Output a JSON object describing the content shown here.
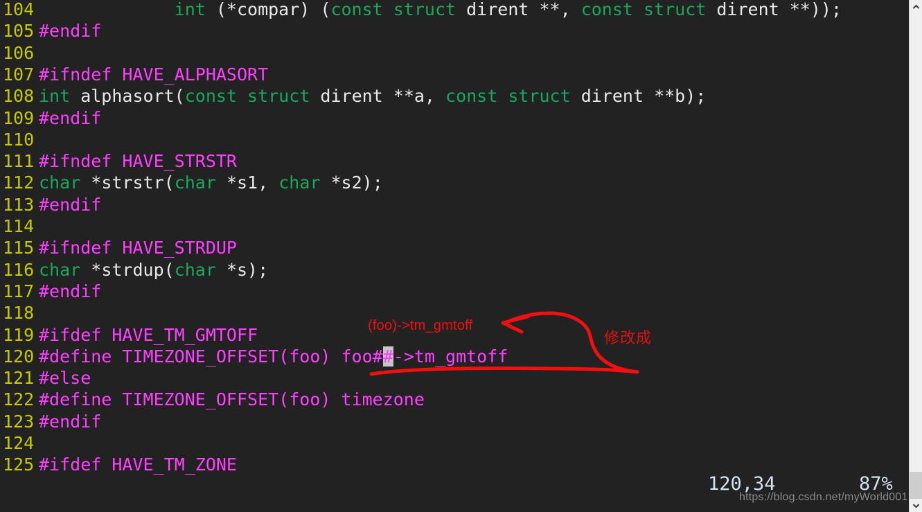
{
  "editor": {
    "kind": "vim-terminal-editor",
    "background_color": "#222222",
    "lines": [
      {
        "number": "104",
        "tokens": [
          {
            "t": "             ",
            "c": "plain"
          },
          {
            "t": "int",
            "c": "type"
          },
          {
            "t": " (*compar) (",
            "c": "plain"
          },
          {
            "t": "const struct",
            "c": "type"
          },
          {
            "t": " dirent **, ",
            "c": "plain"
          },
          {
            "t": "const struct",
            "c": "type"
          },
          {
            "t": " dirent **));",
            "c": "plain"
          }
        ]
      },
      {
        "number": "105",
        "tokens": [
          {
            "t": "#endif",
            "c": "pre"
          }
        ]
      },
      {
        "number": "106",
        "tokens": [
          {
            "t": "",
            "c": "plain"
          }
        ]
      },
      {
        "number": "107",
        "tokens": [
          {
            "t": "#ifndef HAVE_ALPHASORT",
            "c": "pre"
          }
        ]
      },
      {
        "number": "108",
        "tokens": [
          {
            "t": "int",
            "c": "type"
          },
          {
            "t": " alphasort(",
            "c": "plain"
          },
          {
            "t": "const struct",
            "c": "type"
          },
          {
            "t": " dirent **a, ",
            "c": "plain"
          },
          {
            "t": "const struct",
            "c": "type"
          },
          {
            "t": " dirent **b);",
            "c": "plain"
          }
        ]
      },
      {
        "number": "109",
        "tokens": [
          {
            "t": "#endif",
            "c": "pre"
          }
        ]
      },
      {
        "number": "110",
        "tokens": [
          {
            "t": "",
            "c": "plain"
          }
        ]
      },
      {
        "number": "111",
        "tokens": [
          {
            "t": "#ifndef HAVE_STRSTR",
            "c": "pre"
          }
        ]
      },
      {
        "number": "112",
        "tokens": [
          {
            "t": "char",
            "c": "type"
          },
          {
            "t": " *strstr(",
            "c": "plain"
          },
          {
            "t": "char",
            "c": "type"
          },
          {
            "t": " *s1, ",
            "c": "plain"
          },
          {
            "t": "char",
            "c": "type"
          },
          {
            "t": " *s2);",
            "c": "plain"
          }
        ]
      },
      {
        "number": "113",
        "tokens": [
          {
            "t": "#endif",
            "c": "pre"
          }
        ]
      },
      {
        "number": "114",
        "tokens": [
          {
            "t": "",
            "c": "plain"
          }
        ]
      },
      {
        "number": "115",
        "tokens": [
          {
            "t": "#ifndef HAVE_STRDUP",
            "c": "pre"
          }
        ]
      },
      {
        "number": "116",
        "tokens": [
          {
            "t": "char",
            "c": "type"
          },
          {
            "t": " *strdup(",
            "c": "plain"
          },
          {
            "t": "char",
            "c": "type"
          },
          {
            "t": " *s);",
            "c": "plain"
          }
        ]
      },
      {
        "number": "117",
        "tokens": [
          {
            "t": "#endif",
            "c": "pre"
          }
        ]
      },
      {
        "number": "118",
        "tokens": [
          {
            "t": "",
            "c": "plain"
          }
        ]
      },
      {
        "number": "119",
        "tokens": [
          {
            "t": "#ifdef HAVE_TM_GMTOFF",
            "c": "pre"
          }
        ]
      },
      {
        "number": "120",
        "tokens": [
          {
            "t": "#define TIMEZONE_OFFSET(foo) foo#",
            "c": "pre"
          },
          {
            "t": "#",
            "c": "cursor"
          },
          {
            "t": "->tm_gmtoff",
            "c": "pre"
          }
        ]
      },
      {
        "number": "121",
        "tokens": [
          {
            "t": "#else",
            "c": "pre"
          }
        ]
      },
      {
        "number": "122",
        "tokens": [
          {
            "t": "#define TIMEZONE_OFFSET(foo) timezone",
            "c": "pre"
          }
        ]
      },
      {
        "number": "123",
        "tokens": [
          {
            "t": "#endif",
            "c": "pre"
          }
        ]
      },
      {
        "number": "124",
        "tokens": [
          {
            "t": "",
            "c": "plain"
          }
        ]
      },
      {
        "number": "125",
        "tokens": [
          {
            "t": "#ifdef HAVE_TM_ZONE",
            "c": "pre"
          }
        ]
      }
    ],
    "colors": {
      "line_number": "#c8c800",
      "preprocessor": "#ff40ff",
      "type_keyword": "#17a85a",
      "plain_text": "#e8e8e8",
      "cursor_block": "#c6c6c6"
    }
  },
  "statusline": {
    "cursor_position": "120,34",
    "scroll_percent": "87%"
  },
  "watermark": {
    "text": "https://blog.csdn.net/myWorld001"
  },
  "annotation": {
    "color": "#f01010",
    "target_text": "(foo)->tm_gmtoff",
    "label_cn": "修改成",
    "underline_note": "red underline beneath line 120",
    "arrow_note": "curved red arrow pointing left toward the corrected text"
  },
  "scrollbar": {
    "track_color": "#f0f0f0",
    "thumb_color": "#cdcdcd",
    "up_arrow_icon": "chevron-up-icon",
    "down_arrow_icon": "chevron-down-icon"
  }
}
